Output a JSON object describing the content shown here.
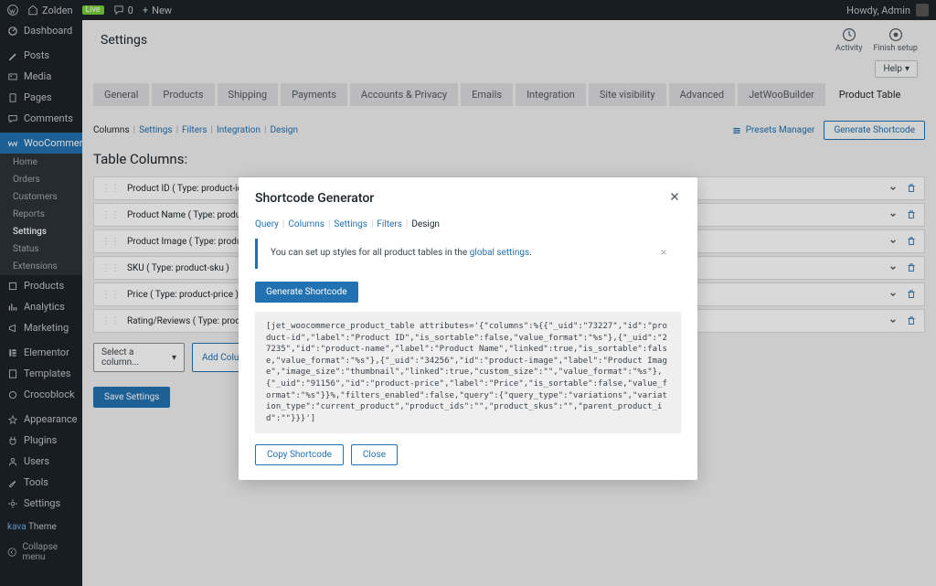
{
  "adminbar": {
    "site": "Zolden",
    "live": "Live",
    "comments": "0",
    "new": "New",
    "howdy": "Howdy, Admin"
  },
  "sidebar": {
    "dashboard": "Dashboard",
    "posts": "Posts",
    "media": "Media",
    "pages": "Pages",
    "comments": "Comments",
    "woocommerce": "WooCommerce",
    "sub": {
      "home": "Home",
      "orders": "Orders",
      "customers": "Customers",
      "reports": "Reports",
      "settings": "Settings",
      "status": "Status",
      "extensions": "Extensions"
    },
    "products": "Products",
    "analytics": "Analytics",
    "marketing": "Marketing",
    "elementor": "Elementor",
    "templates": "Templates",
    "crocoblock": "Crocoblock",
    "appearance": "Appearance",
    "plugins": "Plugins",
    "users": "Users",
    "tools": "Tools",
    "settings2": "Settings",
    "theme_brand": "kava",
    "theme": "Theme",
    "collapse": "Collapse menu"
  },
  "page": {
    "title": "Settings",
    "activity": "Activity",
    "finish": "Finish setup",
    "help": "Help"
  },
  "tabs": {
    "general": "General",
    "products": "Products",
    "shipping": "Shipping",
    "payments": "Payments",
    "accounts": "Accounts & Privacy",
    "emails": "Emails",
    "integration": "Integration",
    "visibility": "Site visibility",
    "advanced": "Advanced",
    "jetwoo": "JetWooBuilder",
    "product_table": "Product Table"
  },
  "subnav": {
    "columns": "Columns",
    "settings": "Settings",
    "filters": "Filters",
    "integration": "Integration",
    "design": "Design",
    "presets": "Presets Manager",
    "generate": "Generate Shortcode"
  },
  "section_title": "Table Columns:",
  "columns": [
    "Product ID ( Type: product-id )",
    "Product Name ( Type: product-name )",
    "Product Image ( Type: product-image )",
    "SKU ( Type: product-sku )",
    "Price ( Type: product-price )",
    "Rating/Reviews ( Type: product-reviews )"
  ],
  "select_placeholder": "Select a column...",
  "add_column": "Add Column",
  "save": "Save Settings",
  "modal": {
    "title": "Shortcode Generator",
    "tabs": {
      "query": "Query",
      "columns": "Columns",
      "settings": "Settings",
      "filters": "Filters",
      "design": "Design"
    },
    "info_prefix": "You can set up styles for all product tables in the ",
    "info_link": "global settings",
    "info_suffix": ".",
    "generate": "Generate Shortcode",
    "code": "[jet_woocommerce_product_table attributes='{\"columns\":%{{\"_uid\":\"73227\",\"id\":\"product-id\",\"label\":\"Product ID\",\"is_sortable\":false,\"value_format\":\"%s\"},{\"_uid\":\"27235\",\"id\":\"product-name\",\"label\":\"Product Name\",\"linked\":true,\"is_sortable\":false,\"value_format\":\"%s\"},{\"_uid\":\"34256\",\"id\":\"product-image\",\"label\":\"Product Image\",\"image_size\":\"thumbnail\",\"linked\":true,\"custom_size\":\"\",\"value_format\":\"%s\"},{\"_uid\":\"91156\",\"id\":\"product-price\",\"label\":\"Price\",\"is_sortable\":false,\"value_format\":\"%s\"}}%,\"filters_enabled\":false,\"query\":{\"query_type\":\"variations\",\"variation_type\":\"current_product\",\"product_ids\":\"\",\"product_skus\":\"\",\"parent_product_id\":\"\"}}}']",
    "copy": "Copy Shortcode",
    "close": "Close"
  }
}
